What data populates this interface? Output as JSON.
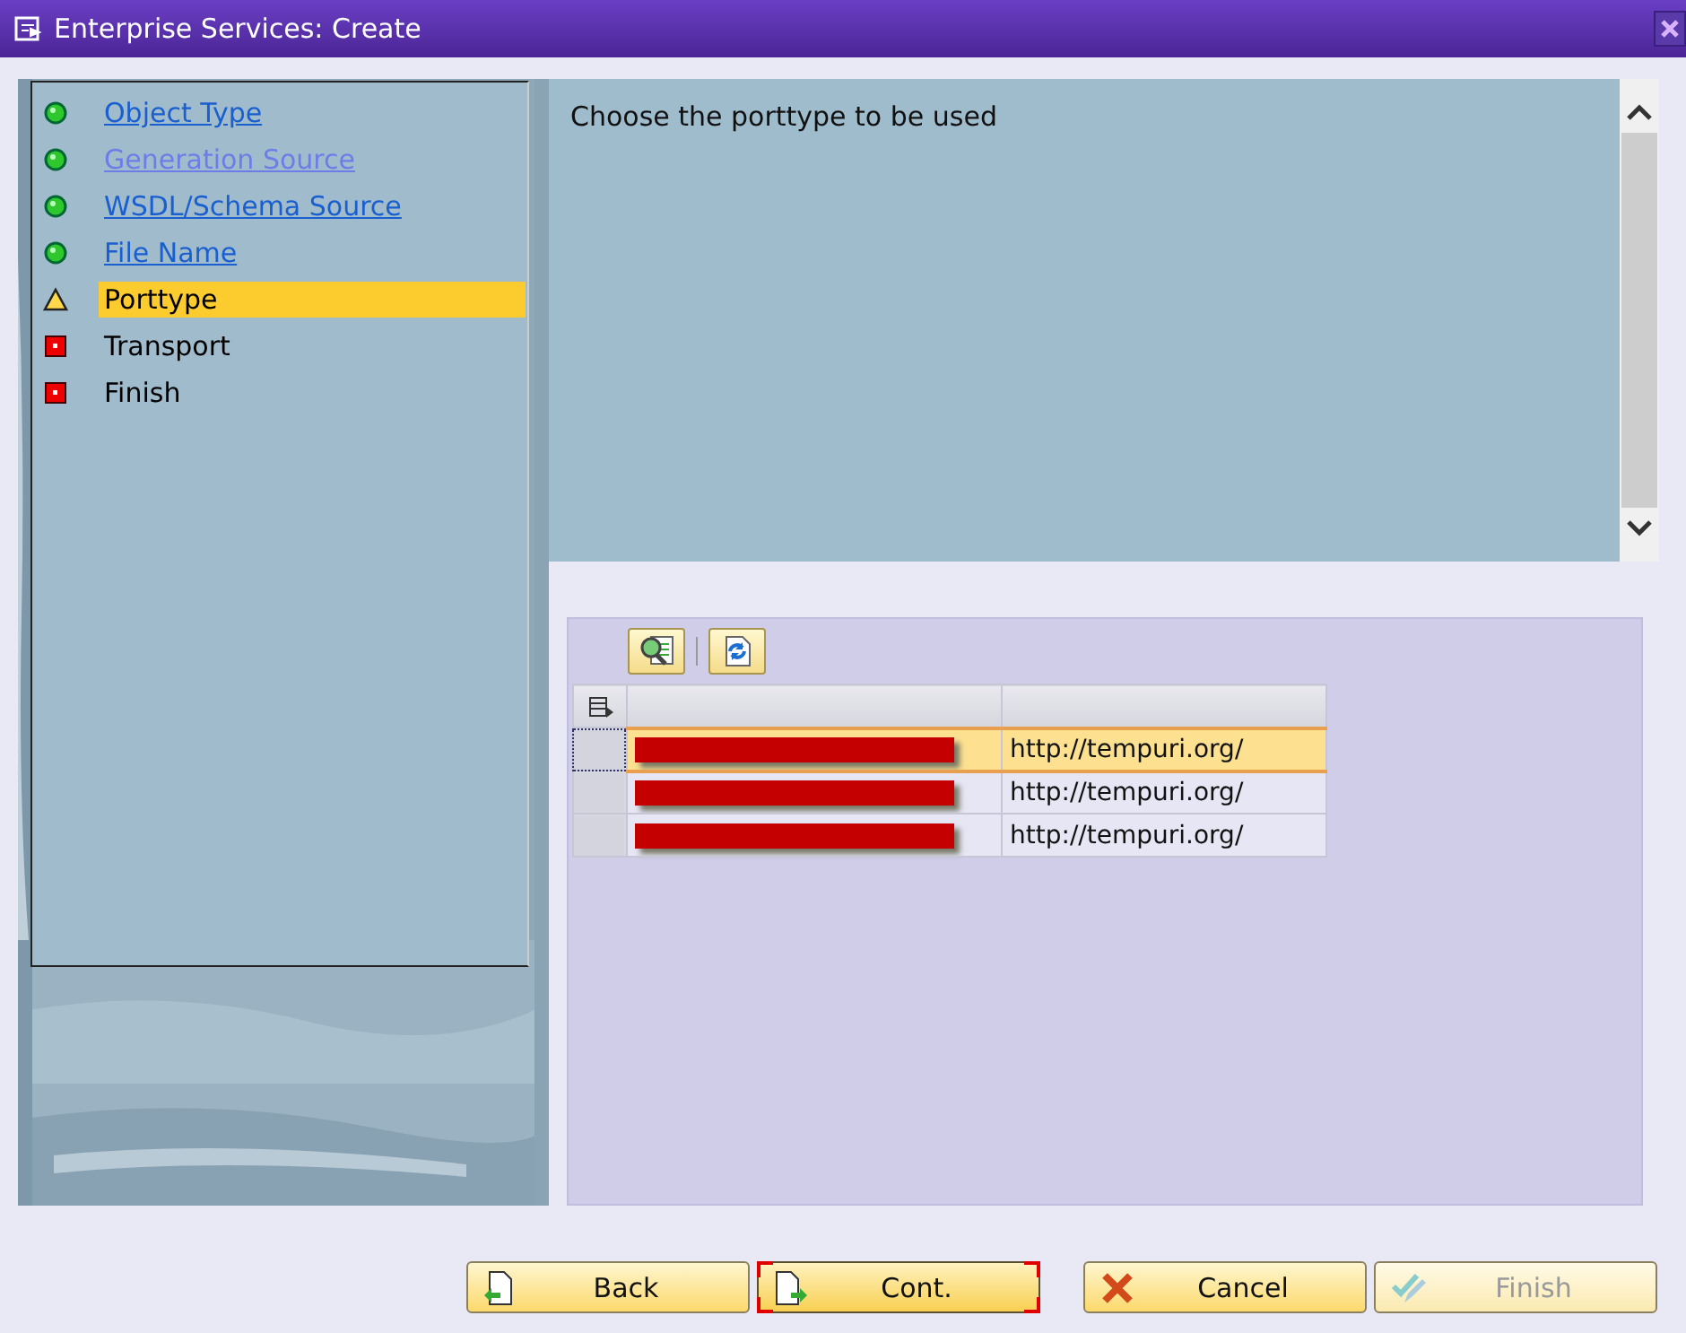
{
  "window": {
    "title": "Enterprise Services: Create"
  },
  "steps": [
    {
      "label": "Object Type",
      "kind": "done",
      "visited": false,
      "selected": false
    },
    {
      "label": "Generation Source",
      "kind": "done",
      "visited": true,
      "selected": false
    },
    {
      "label": "WSDL/Schema Source",
      "kind": "done",
      "visited": false,
      "selected": false
    },
    {
      "label": "File Name",
      "kind": "done",
      "visited": false,
      "selected": false
    },
    {
      "label": "Porttype",
      "kind": "current",
      "visited": false,
      "selected": true
    },
    {
      "label": "Transport",
      "kind": "pending",
      "visited": false,
      "selected": false
    },
    {
      "label": "Finish",
      "kind": "pending",
      "visited": false,
      "selected": false
    }
  ],
  "instruction": "Choose the porttype to be used",
  "table": {
    "rows": [
      {
        "selected": true,
        "column_1_redacted": true,
        "column_2": "http://tempuri.org/"
      },
      {
        "selected": false,
        "column_1_redacted": true,
        "column_2": "http://tempuri.org/"
      },
      {
        "selected": false,
        "column_1_redacted": true,
        "column_2": "http://tempuri.org/"
      }
    ]
  },
  "buttons": [
    {
      "label": "Back",
      "kind": "back",
      "focused": false,
      "disabled": false
    },
    {
      "label": "Cont.",
      "kind": "continue",
      "focused": true,
      "disabled": false
    },
    {
      "label": "Cancel",
      "kind": "cancel",
      "focused": false,
      "disabled": false
    },
    {
      "label": "Finish",
      "kind": "finish",
      "focused": false,
      "disabled": true
    }
  ]
}
